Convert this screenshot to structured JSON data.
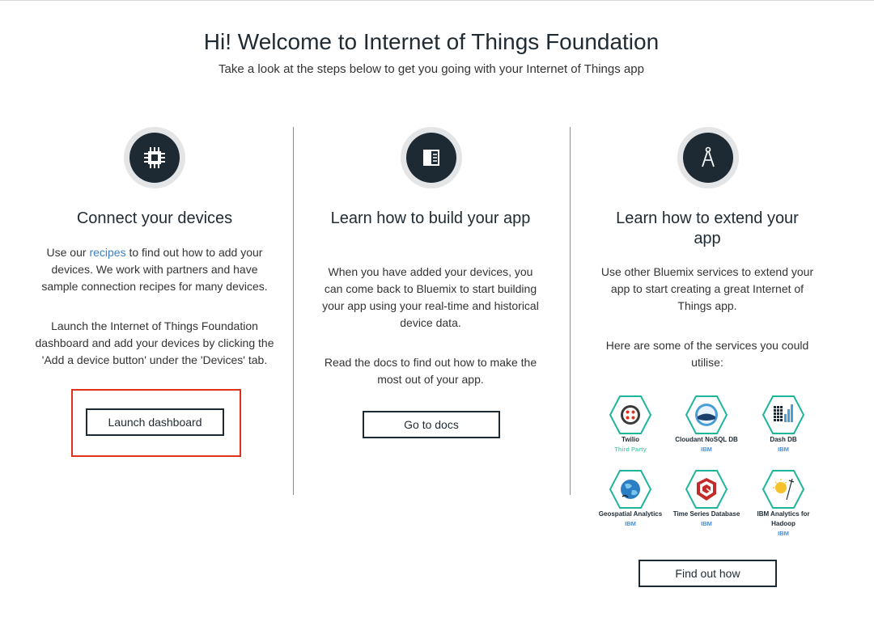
{
  "header": {
    "title": "Hi! Welcome to Internet of Things Foundation",
    "subtitle": "Take a look at the steps below to get you going with your Internet of Things app"
  },
  "columns": [
    {
      "icon": "chip-icon",
      "heading": "Connect your devices",
      "para1_prefix": "Use our ",
      "para1_link": "recipes",
      "para1_suffix": " to find out how to add your devices. We work with partners and have sample connection recipes for many devices.",
      "para2": "Launch the Internet of Things Foundation dashboard and add your devices by clicking the 'Add a device button' under the 'Devices' tab.",
      "button": "Launch dashboard"
    },
    {
      "icon": "book-icon",
      "heading": "Learn how to build your app",
      "para1": "When you have added your devices, you can come back to Bluemix to start building your app using your real-time and historical device data.",
      "para2": "Read the docs to find out how to make the most out of your app.",
      "button": "Go to docs"
    },
    {
      "icon": "compass-icon",
      "heading": "Learn how to extend your app",
      "para1": "Use other Bluemix services to extend your app to start creating a great Internet of Things app.",
      "para2": "Here are some of the services you could utilise:",
      "button": "Find out how"
    }
  ],
  "services": [
    {
      "name": "Twilio",
      "vendor": "Third Party",
      "icon": "twilio-icon"
    },
    {
      "name": "Cloudant NoSQL DB",
      "vendor": "IBM",
      "icon": "cloudant-icon"
    },
    {
      "name": "Dash DB",
      "vendor": "IBM",
      "icon": "dashdb-icon"
    },
    {
      "name": "Geospatial Analytics",
      "vendor": "IBM",
      "icon": "globe-icon"
    },
    {
      "name": "Time Series Database",
      "vendor": "IBM",
      "icon": "time-series-icon"
    },
    {
      "name": "IBM Analytics for Hadoop",
      "vendor": "IBM",
      "icon": "hadoop-icon"
    }
  ],
  "colors": {
    "accent_dark": "#1d2a34",
    "link": "#3b82c4",
    "highlight": "#e0311c",
    "service_hex": "#1fb59b"
  }
}
